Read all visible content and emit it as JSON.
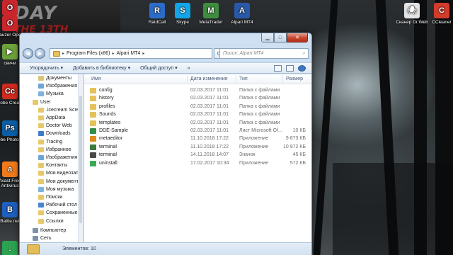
{
  "banner": {
    "top": "DAY",
    "mid": "THE 13TH"
  },
  "desktop_icons": {
    "left": [
      {
        "label": "Opera",
        "color": "#c9262c",
        "glyph": "O"
      },
      {
        "label": "Brauzer Opera",
        "color": "#c9262c",
        "glyph": "O"
      },
      {
        "label": "свичи",
        "color": "#6da23b",
        "glyph": "▶"
      },
      {
        "label": "Adobe Creati...",
        "color": "#d02a1e",
        "glyph": "Cc"
      },
      {
        "label": "Adobe Photosh...",
        "color": "#0b5fa7",
        "glyph": "Ps"
      },
      {
        "label": "Avast Free Antivirus",
        "color": "#f07a1a",
        "glyph": "a"
      },
      {
        "label": "Battle.net",
        "color": "#1f5fbf",
        "glyph": "B"
      },
      {
        "label": "",
        "color": "#2aa44f",
        "glyph": "↓"
      }
    ],
    "top": [
      {
        "label": "RaidCall",
        "color": "#2c6cc9",
        "glyph": "R"
      },
      {
        "label": "Skype",
        "color": "#12a5e8",
        "glyph": "S"
      },
      {
        "label": "MetaTrader",
        "color": "#3e8d3f",
        "glyph": "M"
      },
      {
        "label": "Alpari MT4",
        "color": "#2a58a8",
        "glyph": "A"
      }
    ],
    "right": [
      {
        "label": "Сканер Dr.Web",
        "color": "#e3e3e3",
        "glyph": "🕷"
      },
      {
        "label": "CCleaner",
        "color": "#d33b2b",
        "glyph": "C"
      }
    ]
  },
  "window": {
    "caption_buttons": {
      "minimize": "▁",
      "maximize": "□",
      "close": "✕"
    },
    "breadcrumb": [
      "Program Files (x86)",
      "Alpari MT4"
    ],
    "search_placeholder": "Поиск: Alpari MT4",
    "toolbar": {
      "organize": "Упорядочить ▾",
      "add_to_library": "Добавить в библиотеку ▾",
      "share": "Общий доступ ▾",
      "more": "»"
    },
    "nav_items": [
      {
        "label": "Документы",
        "indent": 1,
        "color": "#d9c477"
      },
      {
        "label": "Изображения",
        "indent": 1,
        "color": "#6ea5d8"
      },
      {
        "label": "Музыка",
        "indent": 1,
        "color": "#7fb1e0"
      },
      {
        "label": "User",
        "indent": 0,
        "color": "#e6c86a"
      },
      {
        "label": ".icecream Scree",
        "indent": 1,
        "color": "#e6c86a"
      },
      {
        "label": "AppData",
        "indent": 1,
        "color": "#e6c86a"
      },
      {
        "label": "Doctor Web",
        "indent": 1,
        "color": "#e6c86a"
      },
      {
        "label": "Downloads",
        "indent": 1,
        "color": "#3f7bc8"
      },
      {
        "label": "Tracing",
        "indent": 1,
        "color": "#e6c86a"
      },
      {
        "label": "Избранное",
        "indent": 1,
        "color": "#e6c86a"
      },
      {
        "label": "Изображения",
        "indent": 1,
        "color": "#6ea5d8"
      },
      {
        "label": "Контакты",
        "indent": 1,
        "color": "#e6c86a"
      },
      {
        "label": "Мои видеозап",
        "indent": 1,
        "color": "#e6c86a"
      },
      {
        "label": "Мои документ",
        "indent": 1,
        "color": "#e6c86a"
      },
      {
        "label": "Моя музыка",
        "indent": 1,
        "color": "#7fb1e0"
      },
      {
        "label": "Поиски",
        "indent": 1,
        "color": "#e6c86a"
      },
      {
        "label": "Рабочий стол",
        "indent": 1,
        "color": "#4a86d0"
      },
      {
        "label": "Сохраненные",
        "indent": 1,
        "color": "#e6c86a"
      },
      {
        "label": "Ссылки",
        "indent": 1,
        "color": "#e6c86a"
      },
      {
        "label": "Компьютер",
        "indent": 0,
        "color": "#7d93ab"
      },
      {
        "label": "Сеть",
        "indent": 0,
        "color": "#7d93ab"
      }
    ],
    "columns": {
      "name": "Имя",
      "date": "Дата изменения",
      "type": "Тип",
      "size": "Размер"
    },
    "files": [
      {
        "name": "config",
        "date": "02.03.2017 11:01",
        "type": "Папка с файлами",
        "size": "",
        "color": "#e6c15a"
      },
      {
        "name": "history",
        "date": "02.03.2017 11:01",
        "type": "Папка с файлами",
        "size": "",
        "color": "#e6c15a"
      },
      {
        "name": "profiles",
        "date": "02.03.2017 11:01",
        "type": "Папка с файлами",
        "size": "",
        "color": "#e6c15a"
      },
      {
        "name": "Sounds",
        "date": "02.03.2017 11:01",
        "type": "Папка с файлами",
        "size": "",
        "color": "#e6c15a"
      },
      {
        "name": "templates",
        "date": "02.03.2017 11:01",
        "type": "Папка с файлами",
        "size": "",
        "color": "#e6c15a"
      },
      {
        "name": "DDE-Sample",
        "date": "02.03.2017 11:01",
        "type": "Лист Microsoft Of...",
        "size": "10 КБ",
        "color": "#2f8f4a"
      },
      {
        "name": "metaeditor",
        "date": "11.10.2018 17:22",
        "type": "Приложение",
        "size": "9 873 КБ",
        "color": "#e08a1c"
      },
      {
        "name": "terminal",
        "date": "11.10.2018 17:22",
        "type": "Приложение",
        "size": "10 972 КБ",
        "color": "#3c7a3e"
      },
      {
        "name": "terminal",
        "date": "14.11.2018 14:07",
        "type": "Значок",
        "size": "45 КБ",
        "color": "#4a4a4a"
      },
      {
        "name": "uninstall",
        "date": "17.02.2017 10:34",
        "type": "Приложение",
        "size": "572 КБ",
        "color": "#3aa850"
      }
    ],
    "status": "Элементов: 10"
  }
}
